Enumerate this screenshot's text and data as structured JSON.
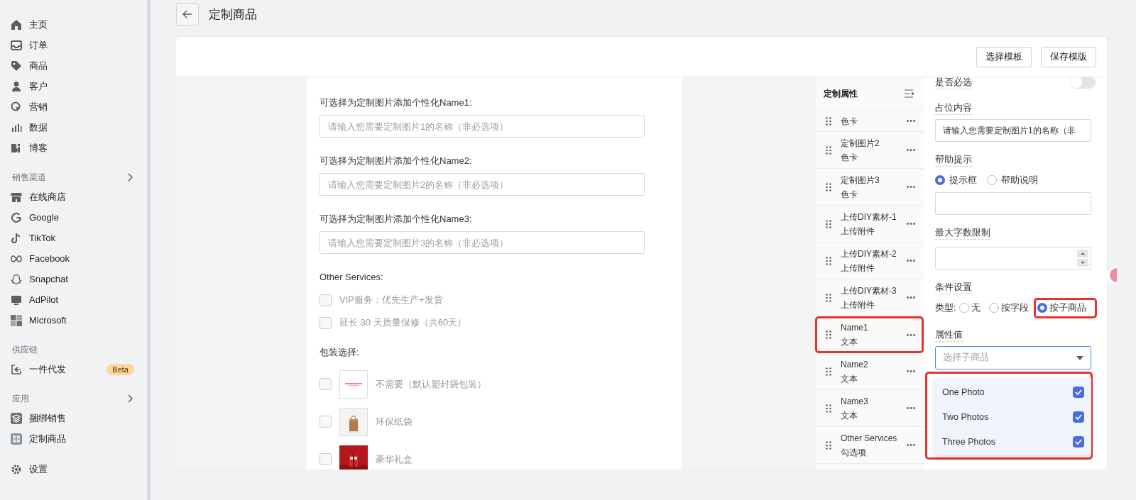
{
  "page": {
    "title": "定制商品"
  },
  "sidebar": {
    "groups": [
      {
        "items": [
          {
            "label": "主页"
          },
          {
            "label": "订单"
          },
          {
            "label": "商品"
          },
          {
            "label": "客户"
          },
          {
            "label": "营销"
          },
          {
            "label": "数据"
          },
          {
            "label": "博客"
          }
        ]
      },
      {
        "heading": "销售渠道",
        "expandable": true,
        "items": [
          {
            "label": "在线商店"
          },
          {
            "label": "Google"
          },
          {
            "label": "TikTok"
          },
          {
            "label": "Facebook"
          },
          {
            "label": "Snapchat"
          },
          {
            "label": "AdPilot"
          },
          {
            "label": "Microsoft"
          }
        ]
      },
      {
        "heading": "供应链",
        "items": [
          {
            "label": "一件代发",
            "badge": "Beta"
          }
        ]
      },
      {
        "heading": "应用",
        "expandable": true,
        "items": [
          {
            "label": "捆绑销售"
          },
          {
            "label": "定制商品"
          }
        ]
      },
      {
        "items": [
          {
            "label": "设置"
          }
        ]
      }
    ]
  },
  "toolbar": {
    "buttons": [
      "选择模板",
      "保存模版"
    ]
  },
  "preview": {
    "name_fields": [
      {
        "label": "可选择为定制图片添加个性化Name1:",
        "placeholder": "请输入您需要定制图片1的名称（非必选项）"
      },
      {
        "label": "可选择为定制图片添加个性化Name2:",
        "placeholder": "请输入您需要定制图片2的名称（非必选项）"
      },
      {
        "label": "可选择为定制图片添加个性化Name3:",
        "placeholder": "请输入您需要定制图片3的名称（非必选项）"
      }
    ],
    "services": {
      "label": "Other Services:",
      "options": [
        {
          "label": "VIP服务：优先生产+发货",
          "checked": false
        },
        {
          "label": "延长 30 天质量保修（共60天）",
          "checked": false
        }
      ]
    },
    "packaging": {
      "label": "包装选择:",
      "options": [
        {
          "label": "不需要（默认塑封袋包装）",
          "checked": false
        },
        {
          "label": "环保纸袋",
          "checked": false
        },
        {
          "label": "豪华礼盒",
          "checked": false
        }
      ]
    }
  },
  "attributes": {
    "title": "定制属性",
    "items": [
      {
        "subtitle": "色卡",
        "highlighted": false
      },
      {
        "name": "定制图片2",
        "subtitle": "色卡",
        "highlighted": false
      },
      {
        "name": "定制图片3",
        "subtitle": "色卡",
        "highlighted": false
      },
      {
        "name": "上传DIY素材-1",
        "subtitle": "上传附件",
        "highlighted": false
      },
      {
        "name": "上传DIY素材-2",
        "subtitle": "上传附件",
        "highlighted": false
      },
      {
        "name": "上传DIY素材-3",
        "subtitle": "上传附件",
        "highlighted": false
      },
      {
        "name": "Name1",
        "subtitle": "文本",
        "highlighted": true
      },
      {
        "name": "Name2",
        "subtitle": "文本",
        "highlighted": false
      },
      {
        "name": "Name3",
        "subtitle": "文本",
        "highlighted": false
      },
      {
        "name": "Other Services",
        "subtitle": "勾选项",
        "highlighted": false
      }
    ]
  },
  "settings": {
    "required": {
      "label": "是否必选",
      "on": false
    },
    "placeholder_content": {
      "label": "占位内容",
      "value": "请输入您需要定制图片1的名称（非"
    },
    "help": {
      "label": "帮助提示",
      "options": [
        {
          "label": "提示框",
          "selected": true
        },
        {
          "label": "帮助说明",
          "selected": false
        }
      ]
    },
    "max_length": {
      "label": "最大字数限制"
    },
    "condition": {
      "label": "条件设置",
      "type_label": "类型:",
      "options": [
        {
          "label": "无",
          "selected": false,
          "highlighted": false
        },
        {
          "label": "按字段",
          "selected": false,
          "highlighted": false
        },
        {
          "label": "按子商品",
          "selected": true,
          "highlighted": true
        }
      ]
    },
    "attribute_value": {
      "label": "属性值",
      "placeholder": "选择子商品",
      "focused": true,
      "highlighted": true,
      "options": [
        {
          "label": "One Photo",
          "checked": true
        },
        {
          "label": "Two Photos",
          "checked": true
        },
        {
          "label": "Three Photos",
          "checked": true
        }
      ]
    }
  }
}
